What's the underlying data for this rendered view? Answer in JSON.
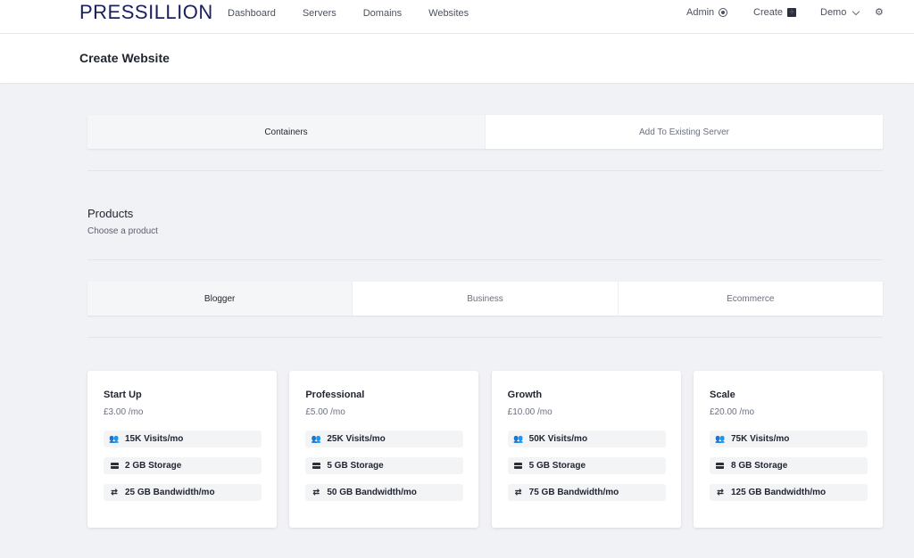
{
  "app": {
    "logo": "PRESSILLION"
  },
  "nav": {
    "links": [
      "Dashboard",
      "Servers",
      "Domains",
      "Websites"
    ],
    "admin": "Admin",
    "create": "Create",
    "user": "Demo"
  },
  "page": {
    "title": "Create Website"
  },
  "server_tabs": [
    {
      "label": "Containers",
      "active": true
    },
    {
      "label": "Add To Existing Server",
      "active": false
    }
  ],
  "products": {
    "title": "Products",
    "subtitle": "Choose a product"
  },
  "category_tabs": [
    {
      "label": "Blogger",
      "active": true
    },
    {
      "label": "Business",
      "active": false
    },
    {
      "label": "Ecommerce",
      "active": false
    }
  ],
  "plans": [
    {
      "name": "Start Up",
      "price": "£3.00 /mo",
      "visits": "15K Visits/mo",
      "storage": "2 GB Storage",
      "bandwidth": "25 GB Bandwidth/mo"
    },
    {
      "name": "Professional",
      "price": "£5.00 /mo",
      "visits": "25K Visits/mo",
      "storage": "5 GB Storage",
      "bandwidth": "50 GB Bandwidth/mo"
    },
    {
      "name": "Growth",
      "price": "£10.00 /mo",
      "visits": "50K Visits/mo",
      "storage": "5 GB Storage",
      "bandwidth": "75 GB Bandwidth/mo"
    },
    {
      "name": "Scale",
      "price": "£20.00 /mo",
      "visits": "75K Visits/mo",
      "storage": "8 GB Storage",
      "bandwidth": "125 GB Bandwidth/mo"
    }
  ],
  "colors": {
    "brand": "#1a1f5e",
    "background": "#f1f2f6"
  }
}
